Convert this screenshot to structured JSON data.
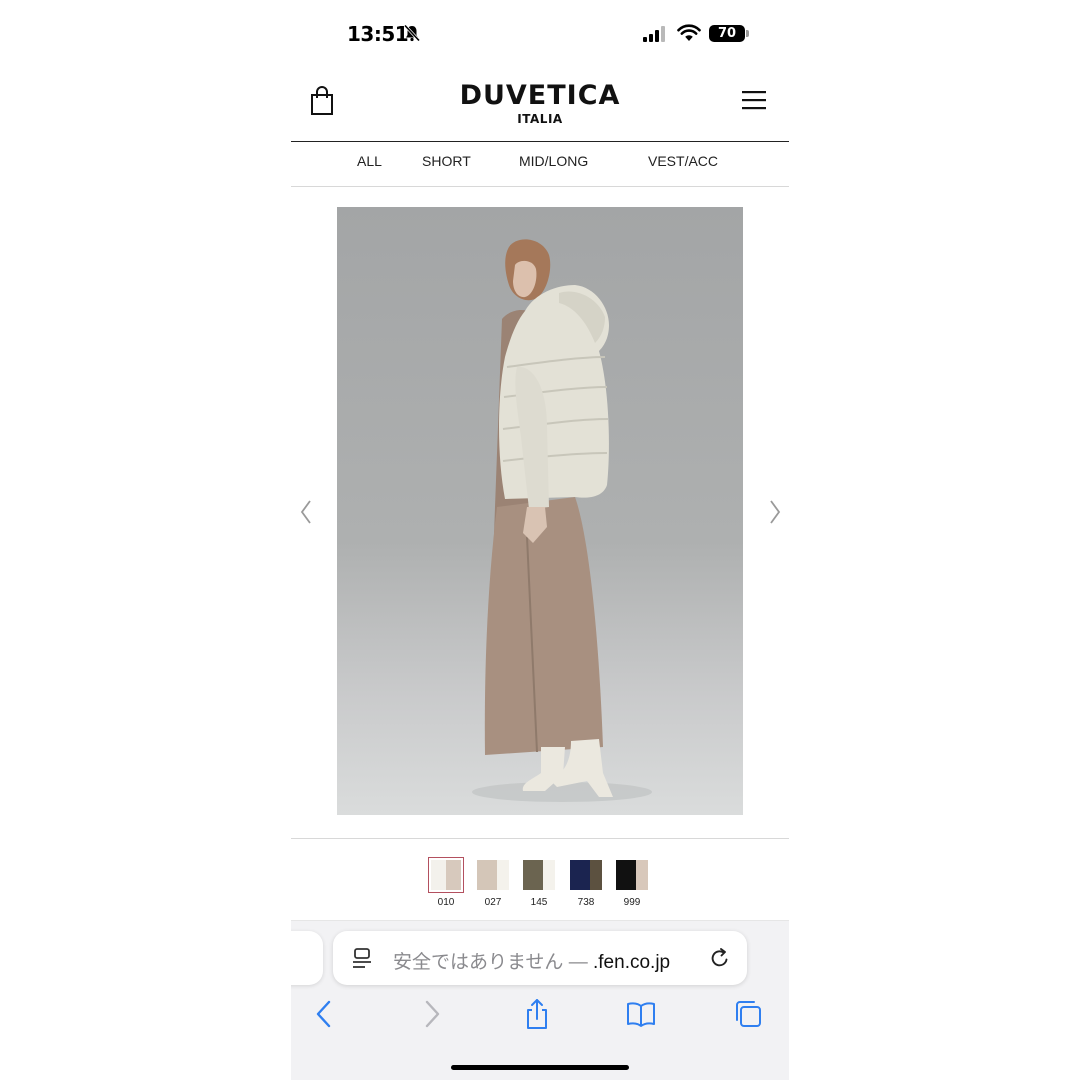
{
  "status_bar": {
    "time": "13:51",
    "battery": "70"
  },
  "header": {
    "brand": "DUVETICA",
    "sub": "ITALIA"
  },
  "tabs": [
    {
      "label": "ALL"
    },
    {
      "label": "SHORT"
    },
    {
      "label": "MID/LONG"
    },
    {
      "label": "VEST/ACC"
    }
  ],
  "swatches": [
    {
      "code": "010",
      "colors": [
        "#f3f1ec",
        "#d7c9bd"
      ],
      "selected": true
    },
    {
      "code": "027",
      "colors": [
        "#d4c6b8",
        "#f4f2ec"
      ]
    },
    {
      "code": "145",
      "colors": [
        "#6b6450",
        "#f4f2ec"
      ]
    },
    {
      "code": "738",
      "colors": [
        "#1b2450",
        "#5c5140"
      ]
    },
    {
      "code": "999",
      "colors": [
        "#111111",
        "#d8c8bb"
      ]
    }
  ],
  "browser": {
    "security_text": "安全ではありません — ",
    "domain": ".fen.co.jp",
    "accent": "#2f7ff0"
  },
  "icons": {
    "cart": "shopping-bag-icon",
    "menu": "hamburger-menu-icon",
    "prev": "chevron-left-icon",
    "next": "chevron-right-icon"
  }
}
